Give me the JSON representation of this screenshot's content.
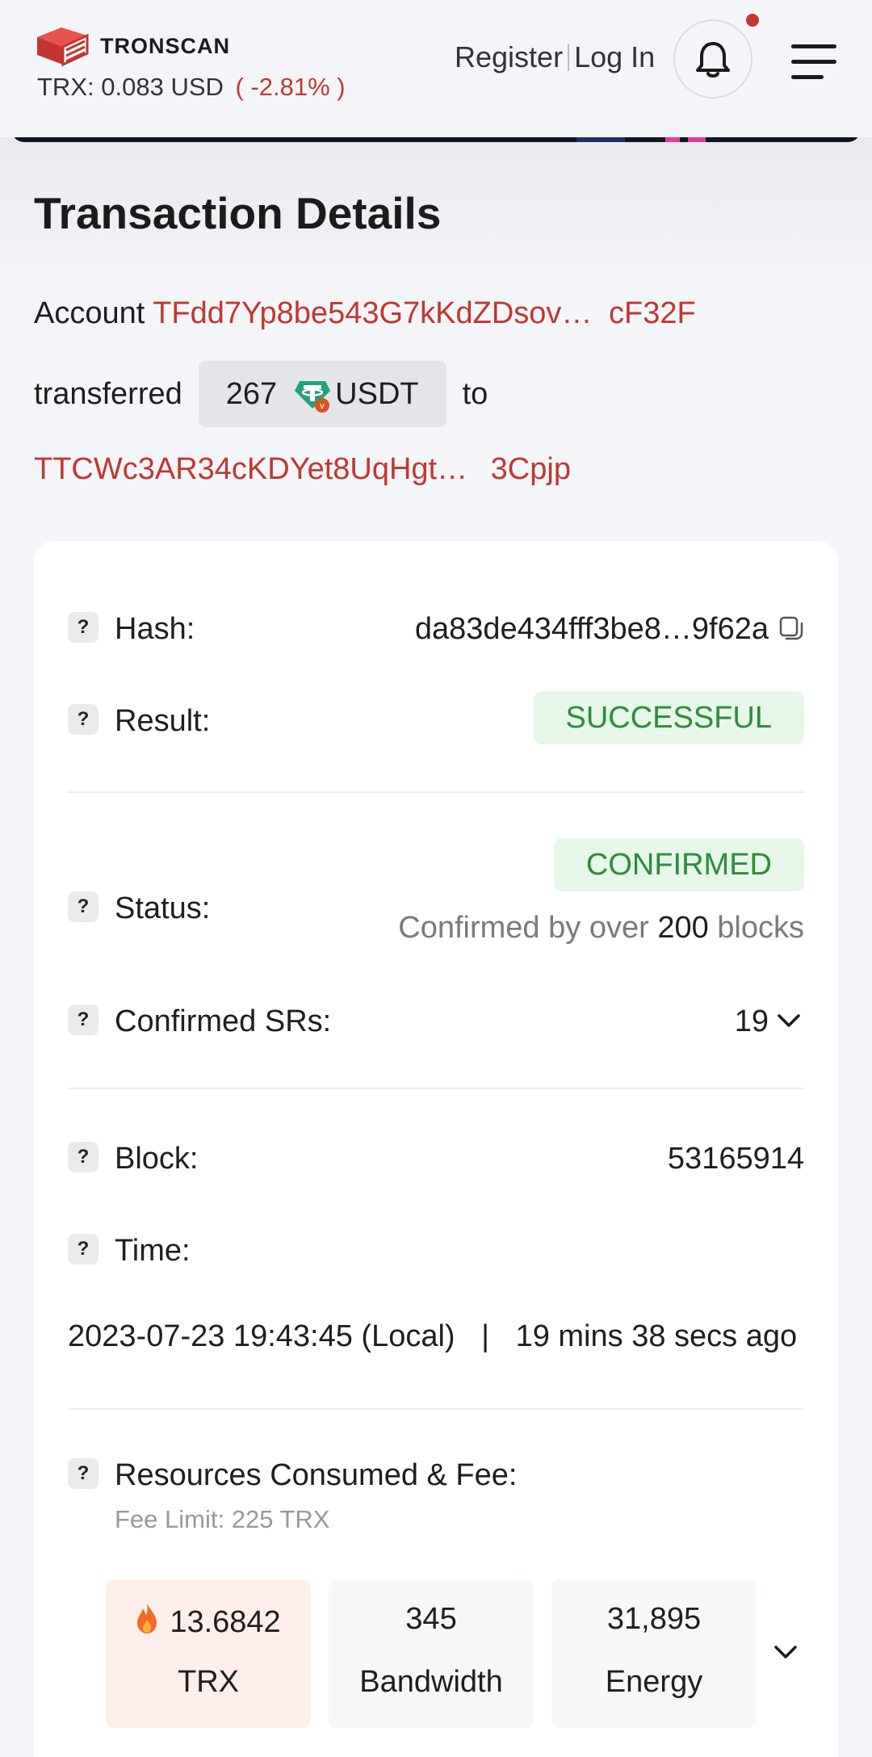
{
  "header": {
    "brand": "TRONSCAN",
    "price_label": "TRX:",
    "price_value": "0.083",
    "price_unit": "USD",
    "price_change": "( -2.81% )",
    "register_label": "Register",
    "login_label": "Log In"
  },
  "page": {
    "title": "Transaction Details",
    "account_label": "Account",
    "from_address": "TFdd7Yp8be543G7kKdZDsov…",
    "from_address_tail": "cF32F",
    "transferred_label": "transferred",
    "amount": "267",
    "token": "USDT",
    "to_label": "to",
    "to_address": "TTCWc3AR34cKDYet8UqHgt…",
    "to_address_tail": "3Cpjp"
  },
  "details": {
    "hash_label": "Hash:",
    "hash_value": "da83de434fff3be8…9f62a",
    "result_label": "Result:",
    "result_value": "SUCCESSFUL",
    "status_label": "Status:",
    "status_value": "CONFIRMED",
    "confirmed_by_prefix": "Confirmed by over",
    "confirmed_by_count": "200",
    "confirmed_by_suffix": "blocks",
    "srs_label": "Confirmed SRs:",
    "srs_value": "19",
    "block_label": "Block:",
    "block_value": "53165914",
    "time_label": "Time:",
    "time_value": "2023-07-23 19:43:45 (Local)",
    "time_separator": "|",
    "time_ago": "19 mins 38 secs ago",
    "resources_label": "Resources Consumed & Fee:",
    "fee_limit": "Fee Limit: 225 TRX",
    "fee_trx_value": "13.6842",
    "fee_trx_unit": "TRX",
    "bandwidth_value": "345",
    "bandwidth_unit": "Bandwidth",
    "energy_value": "31,895",
    "energy_unit": "Energy"
  },
  "help_icon_glyph": "?",
  "colors": {
    "accent_red": "#c23631",
    "success_green": "#2e8b3a",
    "success_bg": "#e6f6e9",
    "page_bg": "#f4f5f9"
  },
  "icons": [
    "tronscan-logo",
    "bell-icon",
    "menu-icon",
    "usdt-token-icon",
    "copy-icon",
    "chevron-down-icon",
    "fire-icon",
    "help-icon"
  ]
}
